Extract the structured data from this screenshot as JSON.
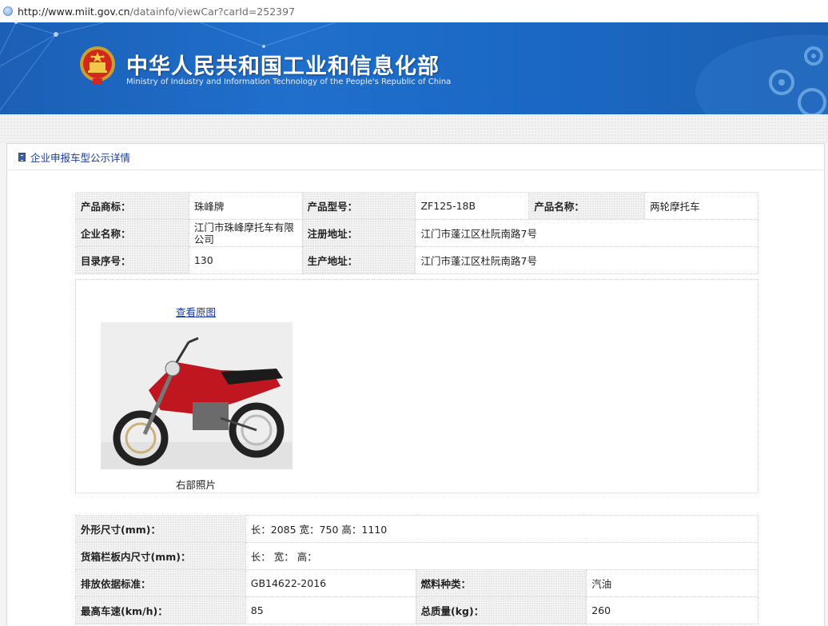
{
  "browser": {
    "url_host": "http://www.miit.gov.cn",
    "url_path": "/datainfo/viewCar?carId=252397"
  },
  "banner": {
    "title_cn": "中华人民共和国工业和信息化部",
    "title_en": "Ministry of Industry and Information Technology of the People's Republic of China"
  },
  "panel": {
    "heading_link": "企业申报车型公示详情"
  },
  "basic_info": {
    "brand_label": "产品商标：",
    "brand_value": "珠峰牌",
    "model_label": "产品型号：",
    "model_value": "ZF125-18B",
    "product_name_label": "产品名称：",
    "product_name_value": "两轮摩托车",
    "company_label": "企业名称：",
    "company_value": "江门市珠峰摩托车有限公司",
    "reg_address_label": "注册地址：",
    "reg_address_value": "江门市蓬江区杜阮南路7号",
    "catalog_no_label": "目录序号：",
    "catalog_no_value": "130",
    "prod_address_label": "生产地址：",
    "prod_address_value": "江门市蓬江区杜阮南路7号"
  },
  "photo": {
    "view_original_link": "查看原图",
    "caption": "右部照片"
  },
  "specs": {
    "dimensions_label": "外形尺寸(mm)：",
    "dimensions_value": "长：2085 宽：750 高：1110",
    "cargo_label": "货箱栏板内尺寸(mm)：",
    "cargo_value": "长： 宽： 高：",
    "emission_label": "排放依据标准：",
    "emission_value": "GB14622-2016",
    "fuel_label": "燃料种类：",
    "fuel_value": "汽油",
    "speed_label": "最高车速(km/h)：",
    "speed_value": "85",
    "mass_label": "总质量(kg)：",
    "mass_value": "260"
  },
  "colors": {
    "banner_blue": "#1f6fcb",
    "link_blue": "#1a3a9e"
  }
}
